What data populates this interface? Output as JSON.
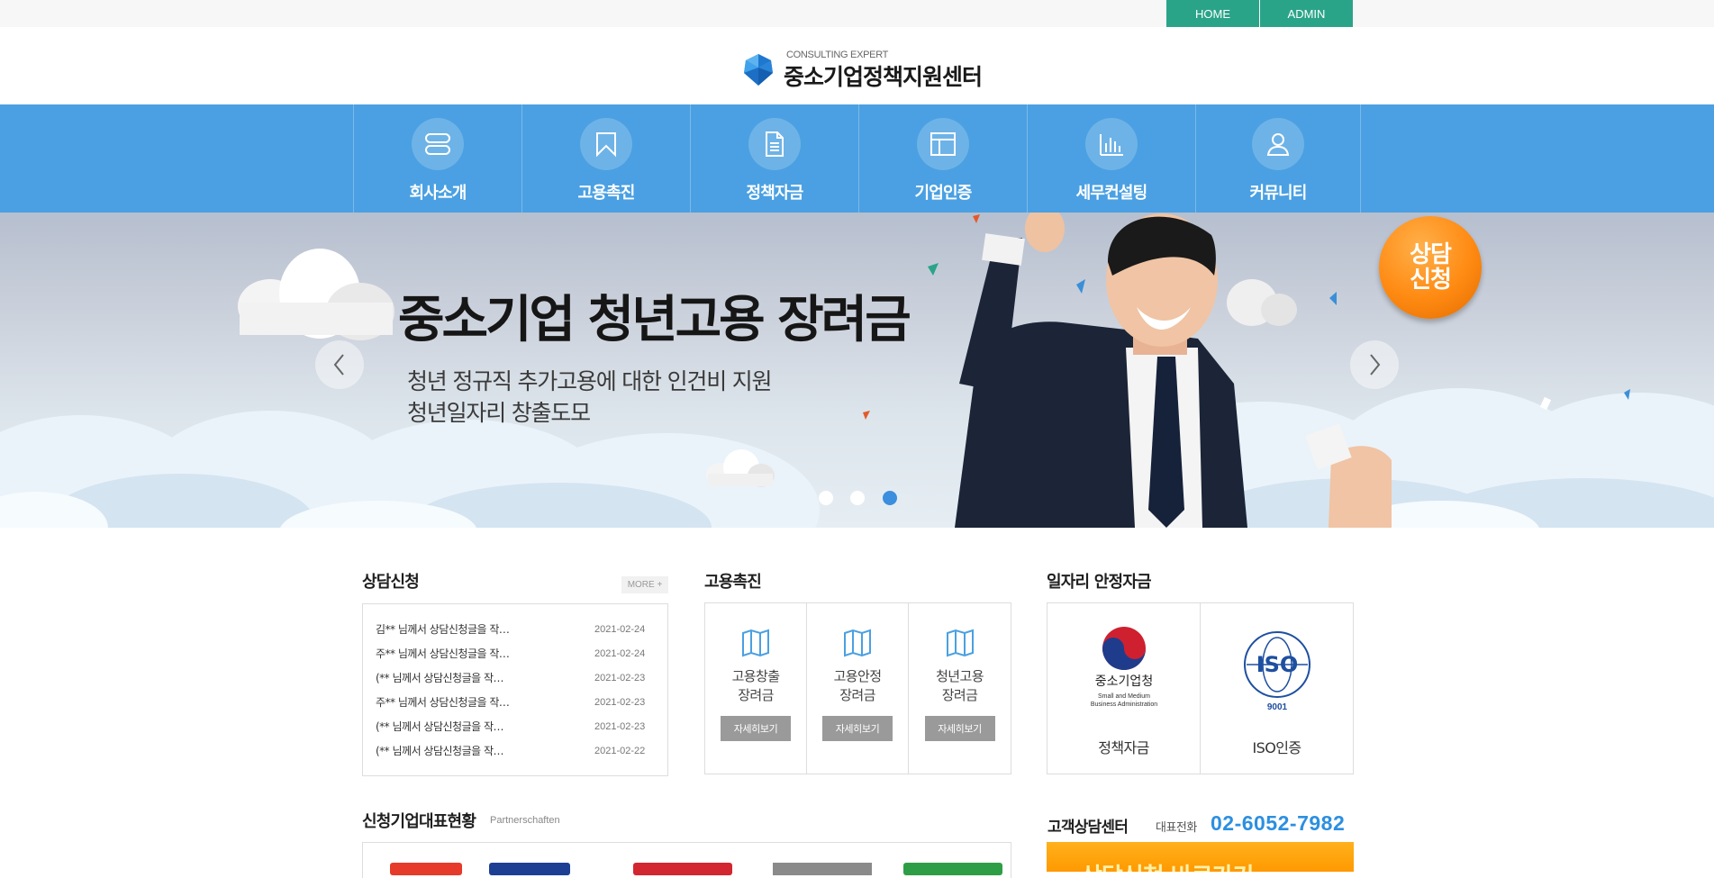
{
  "topbar": {
    "home_label": "HOME",
    "admin_label": "ADMIN"
  },
  "logo": {
    "subtitle": "CONSULTING EXPERT",
    "title": "중소기업정책지원센터"
  },
  "nav": {
    "items": [
      {
        "label": "회사소개",
        "icon": "server-icon"
      },
      {
        "label": "고용촉진",
        "icon": "bookmark-icon"
      },
      {
        "label": "정책자금",
        "icon": "document-icon"
      },
      {
        "label": "기업인증",
        "icon": "table-icon"
      },
      {
        "label": "세무컨설팅",
        "icon": "bar-chart-icon"
      },
      {
        "label": "커뮤니티",
        "icon": "user-icon"
      }
    ]
  },
  "hero": {
    "title": "중소기업 청년고용 장려금",
    "line1": "청년 정규직 추가고용에 대한 인건비 지원",
    "line2": "청년일자리 창출도모",
    "badge_line1": "상담",
    "badge_line2": "신청",
    "active_slide": 3,
    "slide_count": 3
  },
  "consult": {
    "title": "상담신청",
    "more_label": "MORE +",
    "rows": [
      {
        "text": "김** 님께서 상담신청글을 작…",
        "date": "2021-02-24"
      },
      {
        "text": "주** 님께서 상담신청글을 작…",
        "date": "2021-02-24"
      },
      {
        "text": "(** 님께서 상담신청글을 작…",
        "date": "2021-02-23"
      },
      {
        "text": "주** 님께서 상담신청글을 작…",
        "date": "2021-02-23"
      },
      {
        "text": "(** 님께서 상담신청글을 작…",
        "date": "2021-02-23"
      },
      {
        "text": "(** 님께서 상담신청글을 작…",
        "date": "2021-02-22"
      }
    ]
  },
  "employment": {
    "title": "고용촉진",
    "items": [
      {
        "line1": "고용창출",
        "line2": "장려금",
        "button": "자세히보기"
      },
      {
        "line1": "고용안정",
        "line2": "장려금",
        "button": "자세히보기"
      },
      {
        "line1": "청년고용",
        "line2": "장려금",
        "button": "자세히보기"
      }
    ]
  },
  "job_fund": {
    "title": "일자리 안정자금",
    "items": [
      {
        "label": "정책자금",
        "logo_name": "중소기업청",
        "logo_en1": "Small and Medium",
        "logo_en2": "Business Administration"
      },
      {
        "label": "ISO인증",
        "logo_text": "ISO",
        "logo_num": "9001",
        "logo_ring": "International Organization for Standardization"
      }
    ]
  },
  "partners": {
    "title": "신청기업대표현황",
    "subtitle": "Partnerschaften"
  },
  "customer_center": {
    "title": "고객상담센터",
    "rep_label": "대표전화",
    "phone": "02-6052-7982",
    "banner_text": "상담신청 바로가기"
  },
  "colors": {
    "top_button": "#2aa489",
    "nav_bg": "#4aa0e2",
    "accent_blue": "#2c8fe0",
    "badge_orange": "#ff8a12",
    "button_gray": "#9a9a9a"
  }
}
